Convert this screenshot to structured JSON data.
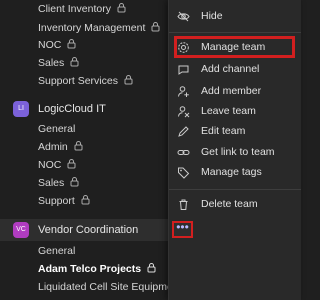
{
  "sidebar": {
    "channels_top": [
      {
        "label": "Client Inventory",
        "locked": true
      },
      {
        "label": "Inventory Management",
        "locked": true
      },
      {
        "label": "NOC",
        "locked": true
      },
      {
        "label": "Sales",
        "locked": true
      },
      {
        "label": "Support Services",
        "locked": true
      }
    ],
    "team_logiccloud": {
      "initials": "LI",
      "name": "LogicCloud IT",
      "badge_color": "#7b61d9",
      "channels": [
        {
          "label": "General",
          "locked": false
        },
        {
          "label": "Admin",
          "locked": true
        },
        {
          "label": "NOC",
          "locked": true
        },
        {
          "label": "Sales",
          "locked": true
        },
        {
          "label": "Support",
          "locked": true
        }
      ]
    },
    "team_vendor": {
      "initials": "VC",
      "name": "Vendor Coordination",
      "badge_color": "#b03cc0",
      "more_label": "•••",
      "channels": [
        {
          "label": "General",
          "locked": false,
          "bold": false
        },
        {
          "label": "Adam Telco Projects",
          "locked": true,
          "bold": true
        },
        {
          "label": "Liquidated Cell Site Equipment",
          "locked": true,
          "bold": false
        }
      ]
    }
  },
  "menu": {
    "items": [
      {
        "label": "Hide",
        "icon": "hide-icon"
      },
      {
        "label": "Manage team",
        "icon": "gear-icon"
      },
      {
        "label": "Add channel",
        "icon": "add-channel-icon"
      },
      {
        "label": "Add member",
        "icon": "add-member-icon"
      },
      {
        "label": "Leave team",
        "icon": "leave-icon"
      },
      {
        "label": "Edit team",
        "icon": "pencil-icon"
      },
      {
        "label": "Get link to team",
        "icon": "link-icon"
      },
      {
        "label": "Manage tags",
        "icon": "tag-icon"
      },
      {
        "label": "Delete team",
        "icon": "trash-icon"
      }
    ],
    "highlight_color": "#d21f1f"
  }
}
